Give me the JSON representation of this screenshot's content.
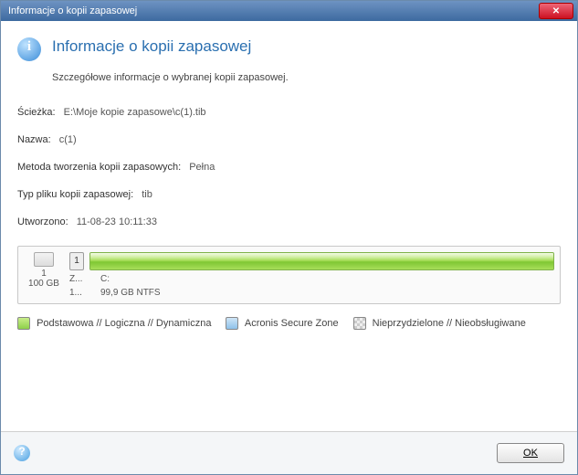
{
  "window": {
    "title": "Informacje o kopii zapasowej"
  },
  "header": {
    "heading": "Informacje o kopii zapasowej",
    "subtext": "Szczegółowe informacje o wybranej kopii zapasowej."
  },
  "fields": {
    "path_label": "Ścieżka:",
    "path_value": "E:\\Moje kopie zapasowe\\c(1).tib",
    "name_label": "Nazwa:",
    "name_value": "c(1)",
    "method_label": "Metoda tworzenia kopii zapasowych:",
    "method_value": "Pełna",
    "filetype_label": "Typ pliku kopii zapasowej:",
    "filetype_value": "tib",
    "created_label": "Utworzono:",
    "created_value": "11-08-23 10:11:33"
  },
  "disk": {
    "index": "1",
    "total_size": "100 GB",
    "col1_label": "Z...",
    "col1_value": "1...",
    "col2_label": "C:",
    "col2_value": "99,9 GB  NTFS"
  },
  "legend": {
    "primary": "Podstawowa // Logiczna // Dynamiczna",
    "asz": "Acronis Secure Zone",
    "unallocated": "Nieprzydzielone // Nieobsługiwane"
  },
  "footer": {
    "ok": "OK"
  },
  "colors": {
    "accent": "#2a6fb0",
    "bar": "#8ed04a"
  }
}
